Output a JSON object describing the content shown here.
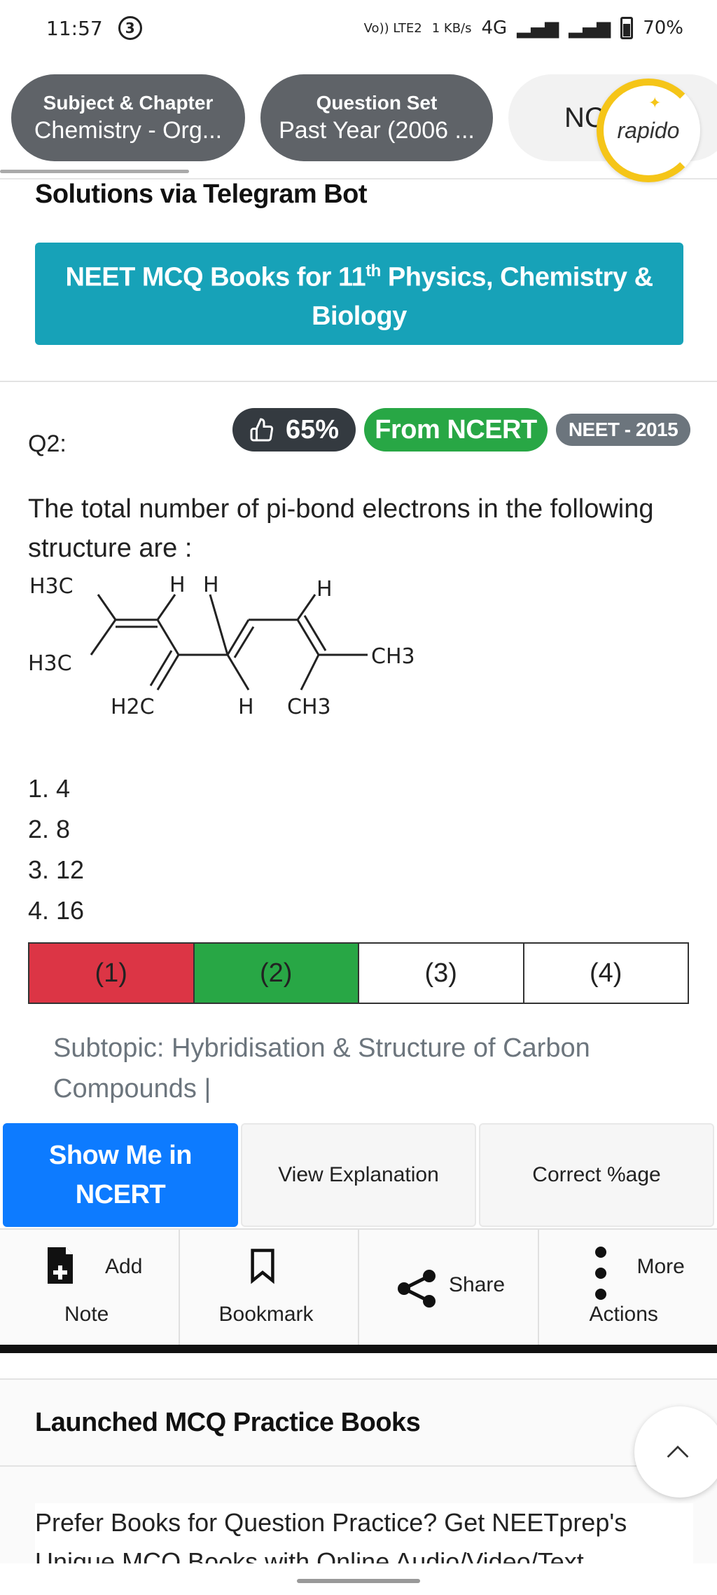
{
  "status_bar": {
    "time": "11:57",
    "notification_count": "3",
    "network_label": "Vo)) LTE2",
    "speed": "1 KB/s",
    "network_type": "4G",
    "battery": "70%"
  },
  "filters": {
    "chip1_title": "Subject & Chapter",
    "chip1_value": "Chemistry - Org...",
    "chip2_title": "Question Set",
    "chip2_value": "Past Year (2006 ...",
    "chip3_value": "NC",
    "ad_label": "rapido"
  },
  "telegram": {
    "title": "Solutions via Telegram Bot",
    "books_button_pre": "NEET MCQ Books for 11",
    "books_button_sup": "th",
    "books_button_post": " Physics, Chemistry &",
    "books_button_line2": "Biology"
  },
  "question": {
    "number": "Q2:",
    "like_percent": "65%",
    "source_badge": "From NCERT",
    "exam_badge": "NEET - 2015",
    "text": "The total number of pi-bond electrons in the following structure are :",
    "structure_labels": {
      "h3c_top": "H3C",
      "h3c_bottom": "H3C",
      "h_1": "H",
      "h_2": "H",
      "h_3": "H",
      "h2c": "H2C",
      "h_bottom": "H",
      "ch3_right": "CH3",
      "ch3_bottom": "CH3"
    },
    "options": [
      "1. 4",
      "2. 8",
      "3. 12",
      "4. 16"
    ],
    "answer_buttons": [
      "(1)",
      "(2)",
      "(3)",
      "(4)"
    ],
    "answer_states": [
      "wrong",
      "correct",
      "neutral",
      "neutral"
    ],
    "subtopic": "Subtopic:  Hybridisation & Structure of Carbon Compounds |"
  },
  "actions": {
    "show_ncert": "Show Me in NCERT",
    "view_explanation": "View Explanation",
    "correct_percentage": "Correct %age"
  },
  "tools": {
    "add_note_1": "Add",
    "add_note_2": "Note",
    "bookmark": "Bookmark",
    "share": "Share",
    "more_1": "More",
    "more_2": "Actions"
  },
  "launched": {
    "heading": "Launched MCQ Practice Books",
    "body": "Prefer Books for Question Practice? Get NEETprep's Unique MCQ Books with Online Audio/Video/Text"
  },
  "colors": {
    "chip_bg": "#5f6368",
    "teal_button": "#17a2b8",
    "green_badge": "#28a745",
    "red_wrong": "#dc3545",
    "blue_primary": "#0d7bff"
  }
}
